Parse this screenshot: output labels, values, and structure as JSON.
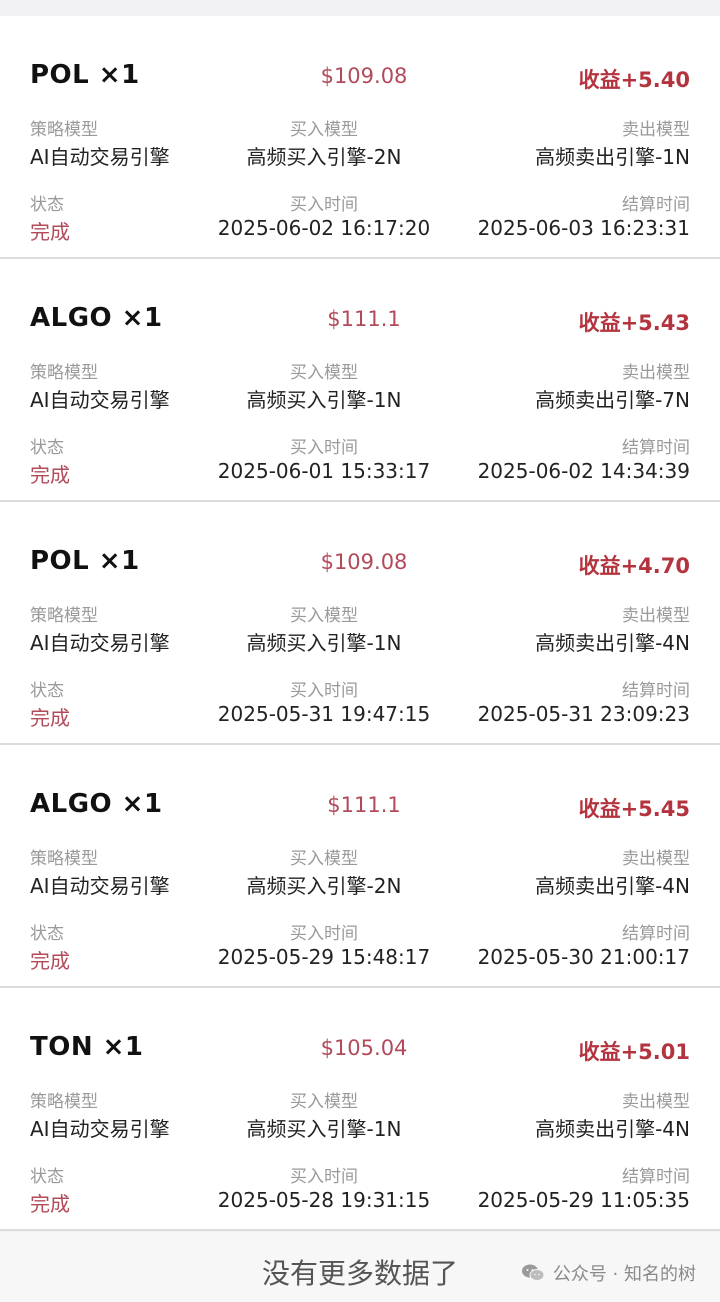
{
  "labels": {
    "strategy_model": "策略模型",
    "buy_model": "买入模型",
    "sell_model": "卖出模型",
    "status": "状态",
    "buy_time": "买入时间",
    "settle_time": "结算时间"
  },
  "trades": [
    {
      "coin": "POL ×1",
      "price": "$109.08",
      "profit": "收益+5.40",
      "strategy": "AI自动交易引擎",
      "buy_model": "高频买入引擎-2N",
      "sell_model": "高频卖出引擎-1N",
      "status": "完成",
      "buy_time": "2025-06-02 16:17:20",
      "settle_time": "2025-06-03 16:23:31"
    },
    {
      "coin": "ALGO ×1",
      "price": "$111.1",
      "profit": "收益+5.43",
      "strategy": "AI自动交易引擎",
      "buy_model": "高频买入引擎-1N",
      "sell_model": "高频卖出引擎-7N",
      "status": "完成",
      "buy_time": "2025-06-01 15:33:17",
      "settle_time": "2025-06-02 14:34:39"
    },
    {
      "coin": "POL ×1",
      "price": "$109.08",
      "profit": "收益+4.70",
      "strategy": "AI自动交易引擎",
      "buy_model": "高频买入引擎-1N",
      "sell_model": "高频卖出引擎-4N",
      "status": "完成",
      "buy_time": "2025-05-31 19:47:15",
      "settle_time": "2025-05-31 23:09:23"
    },
    {
      "coin": "ALGO ×1",
      "price": "$111.1",
      "profit": "收益+5.45",
      "strategy": "AI自动交易引擎",
      "buy_model": "高频买入引擎-2N",
      "sell_model": "高频卖出引擎-4N",
      "status": "完成",
      "buy_time": "2025-05-29 15:48:17",
      "settle_time": "2025-05-30 21:00:17"
    },
    {
      "coin": "TON ×1",
      "price": "$105.04",
      "profit": "收益+5.01",
      "strategy": "AI自动交易引擎",
      "buy_model": "高频买入引擎-1N",
      "sell_model": "高频卖出引擎-4N",
      "status": "完成",
      "buy_time": "2025-05-28 19:31:15",
      "settle_time": "2025-05-29 11:05:35"
    }
  ],
  "footer": {
    "no_more": "没有更多数据了",
    "watermark": "公众号 · 知名的树",
    "watermark_icon": "wechat-icon"
  },
  "colors": {
    "accent_red": "#b3343f",
    "status_red": "#b24a5a"
  }
}
